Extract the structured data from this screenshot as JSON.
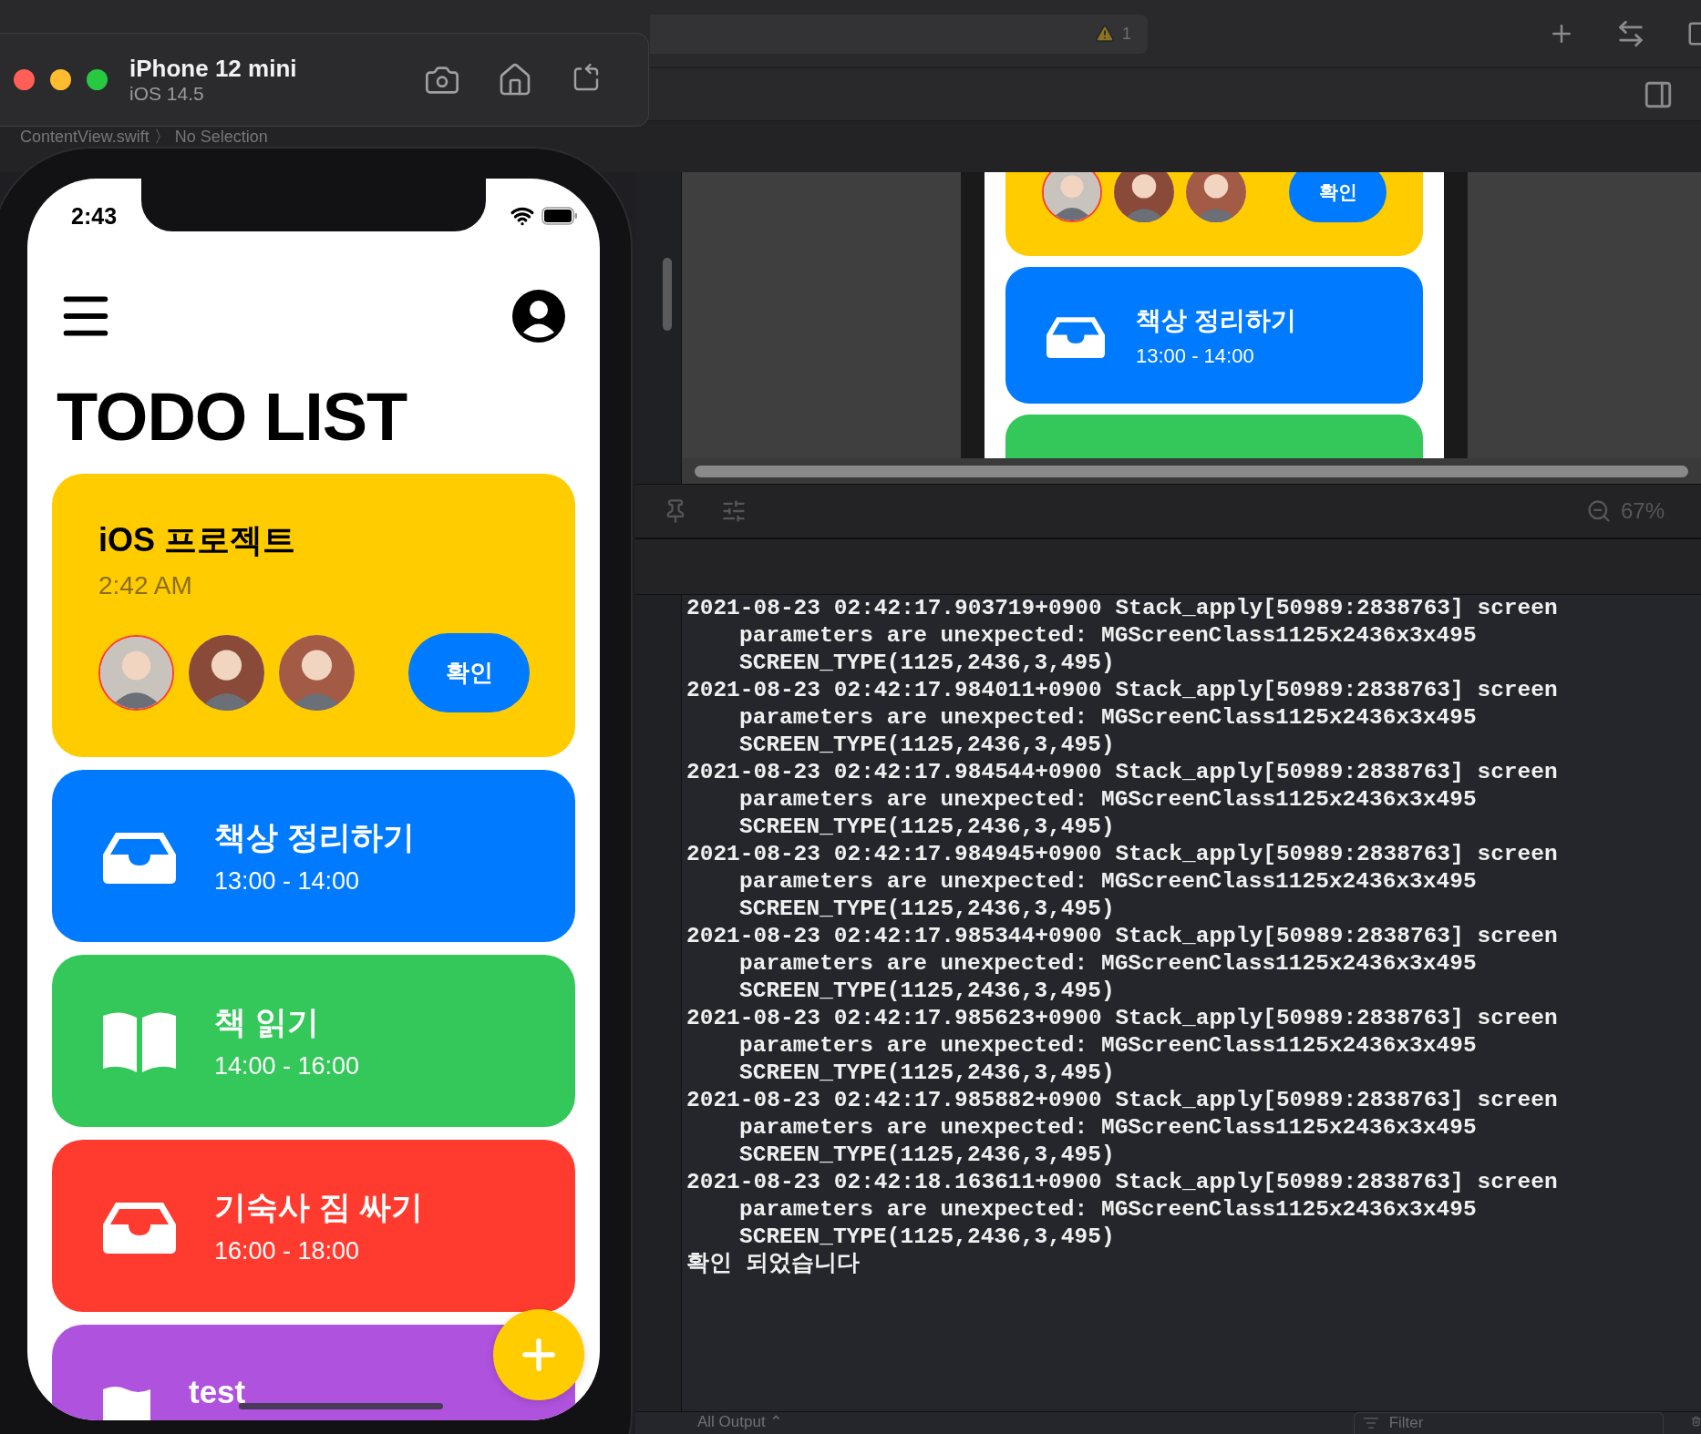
{
  "xcode": {
    "warning_count": "1",
    "breadcrumb": "ContentView.swift 〉 No Selection",
    "zoom": "67%",
    "console": [
      [
        "2021-08-23 02:42:17.903719+0900 Stack_apply[50989:2838763] screen",
        "parameters are unexpected: MGScreenClass1125x2436x3x495",
        "SCREEN_TYPE(1125,2436,3,495)"
      ],
      [
        "2021-08-23 02:42:17.984011+0900 Stack_apply[50989:2838763] screen",
        "parameters are unexpected: MGScreenClass1125x2436x3x495",
        "SCREEN_TYPE(1125,2436,3,495)"
      ],
      [
        "2021-08-23 02:42:17.984544+0900 Stack_apply[50989:2838763] screen",
        "parameters are unexpected: MGScreenClass1125x2436x3x495",
        "SCREEN_TYPE(1125,2436,3,495)"
      ],
      [
        "2021-08-23 02:42:17.984945+0900 Stack_apply[50989:2838763] screen",
        "parameters are unexpected: MGScreenClass1125x2436x3x495",
        "SCREEN_TYPE(1125,2436,3,495)"
      ],
      [
        "2021-08-23 02:42:17.985344+0900 Stack_apply[50989:2838763] screen",
        "parameters are unexpected: MGScreenClass1125x2436x3x495",
        "SCREEN_TYPE(1125,2436,3,495)"
      ],
      [
        "2021-08-23 02:42:17.985623+0900 Stack_apply[50989:2838763] screen",
        "parameters are unexpected: MGScreenClass1125x2436x3x495",
        "SCREEN_TYPE(1125,2436,3,495)"
      ],
      [
        "2021-08-23 02:42:17.985882+0900 Stack_apply[50989:2838763] screen",
        "parameters are unexpected: MGScreenClass1125x2436x3x495",
        "SCREEN_TYPE(1125,2436,3,495)"
      ],
      [
        "2021-08-23 02:42:18.163611+0900 Stack_apply[50989:2838763] screen",
        "parameters are unexpected: MGScreenClass1125x2436x3x495",
        "SCREEN_TYPE(1125,2436,3,495)"
      ],
      [
        "확인 되었습니다"
      ]
    ],
    "output_filter": "All Output ⌃",
    "filter_placeholder": "Filter"
  },
  "preview": {
    "cards": [
      {
        "kind": "project",
        "color": "#ffcc00",
        "members": [
          {
            "highlighted": true
          },
          {
            "highlighted": false
          },
          {
            "highlighted": false
          }
        ],
        "button": "확인"
      },
      {
        "kind": "tray",
        "title": "책상 정리하기",
        "time": "13:00 - 14:00",
        "color": "#007aff"
      },
      {
        "kind": "blank",
        "color": "#34c759"
      }
    ]
  },
  "simulator": {
    "device": "iPhone 12 mini",
    "os": "iOS 14.5"
  },
  "app": {
    "time": "2:43",
    "title": "TODO LIST",
    "todos": [
      {
        "kind": "project",
        "title": "iOS 프로젝트",
        "time": "2:42 AM",
        "color": "#ffcc00",
        "members": [
          {
            "highlighted": true
          },
          {
            "highlighted": false
          },
          {
            "highlighted": false
          }
        ],
        "button": "확인"
      },
      {
        "kind": "tray",
        "title": "책상 정리하기",
        "time": "13:00 - 14:00",
        "color": "#007aff"
      },
      {
        "kind": "book",
        "title": "책 읽기",
        "time": "14:00 - 16:00",
        "color": "#34c759"
      },
      {
        "kind": "tray",
        "title": "기숙사 짐 싸기",
        "time": "16:00 - 18:00",
        "color": "#ff3b30"
      },
      {
        "kind": "flag",
        "title": "test",
        "color": "#af52de"
      }
    ]
  }
}
